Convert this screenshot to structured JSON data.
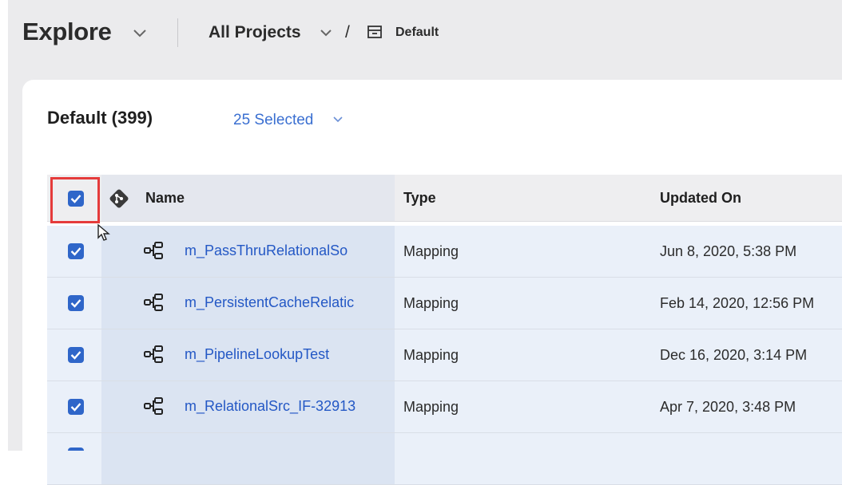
{
  "header": {
    "title": "Explore",
    "projects_label": "All Projects",
    "separator": "/",
    "current_folder": "Default"
  },
  "panel": {
    "title": "Default (399)",
    "selection_label": "25 Selected"
  },
  "table": {
    "columns": [
      "Name",
      "Type",
      "Updated On"
    ],
    "rows": [
      {
        "name": "m_PassThruRelationalSo",
        "type": "Mapping",
        "updated": "Jun 8, 2020, 5:38 PM",
        "checked": true
      },
      {
        "name": "m_PersistentCacheRelatic",
        "type": "Mapping",
        "updated": "Feb 14, 2020, 12:56 PM",
        "checked": true
      },
      {
        "name": "m_PipelineLookupTest",
        "type": "Mapping",
        "updated": "Dec 16, 2020, 3:14 PM",
        "checked": true
      },
      {
        "name": "m_RelationalSrc_IF-32913",
        "type": "Mapping",
        "updated": "Apr 7, 2020, 3:48 PM",
        "checked": true
      }
    ]
  },
  "colors": {
    "accent": "#2f66c9",
    "link": "#2458c5",
    "highlight": "#e53b3b"
  },
  "icons": [
    "chevron-down-icon",
    "folder-icon",
    "git-icon",
    "mapping-icon",
    "checkbox-checked-icon",
    "mouse-cursor-icon"
  ]
}
